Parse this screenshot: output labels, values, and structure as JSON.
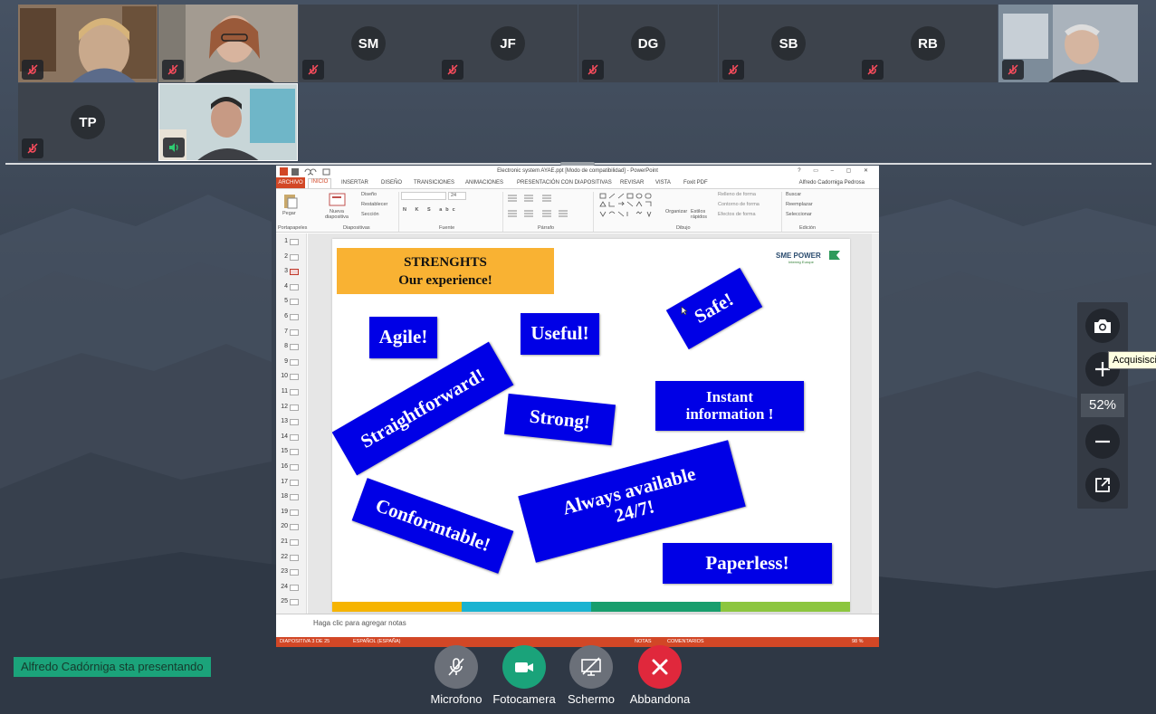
{
  "participants": [
    {
      "initials": "",
      "video": true,
      "muted": true,
      "mic_icon": "mic-off-icon"
    },
    {
      "initials": "",
      "video": true,
      "muted": true,
      "mic_icon": "mic-off-icon"
    },
    {
      "initials": "SM",
      "video": false,
      "muted": true,
      "mic_icon": "mic-off-icon"
    },
    {
      "initials": "JF",
      "video": false,
      "muted": true,
      "mic_icon": "mic-off-icon"
    },
    {
      "initials": "DG",
      "video": false,
      "muted": true,
      "mic_icon": "mic-off-icon"
    },
    {
      "initials": "SB",
      "video": false,
      "muted": true,
      "mic_icon": "mic-off-icon"
    },
    {
      "initials": "RB",
      "video": false,
      "muted": true,
      "mic_icon": "mic-off-icon"
    },
    {
      "initials": "",
      "video": true,
      "muted": true,
      "mic_icon": "mic-off-icon"
    },
    {
      "initials": "TP",
      "video": false,
      "muted": true,
      "mic_icon": "mic-off-icon"
    },
    {
      "initials": "",
      "video": true,
      "muted": false,
      "speaking": true,
      "mic_icon": "speaker-icon"
    }
  ],
  "ppt": {
    "window_title": "Electronic system AYAE.ppt [Modo de compatibilidad] - PowerPoint",
    "window_controls": "? ▭ – ▢ ✕",
    "tabs": [
      "ARCHIVO",
      "INICIO",
      "INSERTAR",
      "DISEÑO",
      "TRANSICIONES",
      "ANIMACIONES",
      "PRESENTACIÓN CON DIAPOSITIVAS",
      "REVISAR",
      "VISTA",
      "Foxit PDF"
    ],
    "user": "Alfredo Cadorniga Pedrosa",
    "ribbon": {
      "paste": "Pegar",
      "new_slide": "Nueva diapositiva",
      "layout": "Diseño",
      "reset": "Restablecer",
      "section": "Sección",
      "font_size": "24",
      "arrange": "Organizar",
      "quick_styles": "Estilos rápidos",
      "shape_fill": "Relleno de forma",
      "shape_outline": "Contorno de forma",
      "shape_effects": "Efectos de forma",
      "find": "Buscar",
      "replace": "Reemplazar",
      "select": "Seleccionar",
      "groups": [
        "Portapapeles",
        "Diapositivas",
        "Fuente",
        "Párrafo",
        "Dibujo",
        "Edición"
      ]
    },
    "slide_numbers": [
      "1",
      "2",
      "3",
      "4",
      "5",
      "6",
      "7",
      "8",
      "9",
      "10",
      "11",
      "12",
      "13",
      "14",
      "15",
      "16",
      "17",
      "18",
      "19",
      "20",
      "21",
      "22",
      "23",
      "24",
      "25"
    ],
    "selected_slide": 3,
    "notes_placeholder": "Haga clic para agregar notas",
    "status": {
      "slide_info": "DIAPOSITIVA 3 DE 25",
      "language": "ESPAÑOL (ESPAÑA)",
      "notes": "NOTAS",
      "comments": "COMENTARIOS",
      "zoom": "98 %"
    },
    "slide": {
      "title_line1": "STRENGHTS",
      "title_line2": "Our experience!",
      "logo_text": "SME POWER",
      "logo_sub": "Interreg Europe",
      "tags": {
        "agile": "Agile!",
        "useful": "Useful!",
        "safe": "Safe!",
        "straightforward": "Straightforward!",
        "strong": "Strong!",
        "instant_1": "Instant",
        "instant_2": "information !",
        "always_1": "Always available",
        "always_2": "24/7!",
        "conformtable": "Conformtable!",
        "paperless": "Paperless!"
      },
      "bar_colors": [
        "#f6b400",
        "#1ab3d1",
        "#189e6d",
        "#8cc63f"
      ],
      "tag_color": "#0000e6",
      "title_color": "#f9b233"
    }
  },
  "zoom_panel": {
    "level": "52%",
    "tooltip": "Acquisisci"
  },
  "presenter_banner": "Alfredo Cadórniga sta presentando",
  "controls": [
    {
      "label": "Microfono",
      "icon": "mic-off-icon",
      "color": "#6b7079"
    },
    {
      "label": "Fotocamera",
      "icon": "camera-icon",
      "color": "#1aa37a"
    },
    {
      "label": "Schermo",
      "icon": "screen-share-off-icon",
      "color": "#6b7079"
    },
    {
      "label": "Abbandona",
      "icon": "close-icon",
      "color": "#e0283c"
    }
  ]
}
